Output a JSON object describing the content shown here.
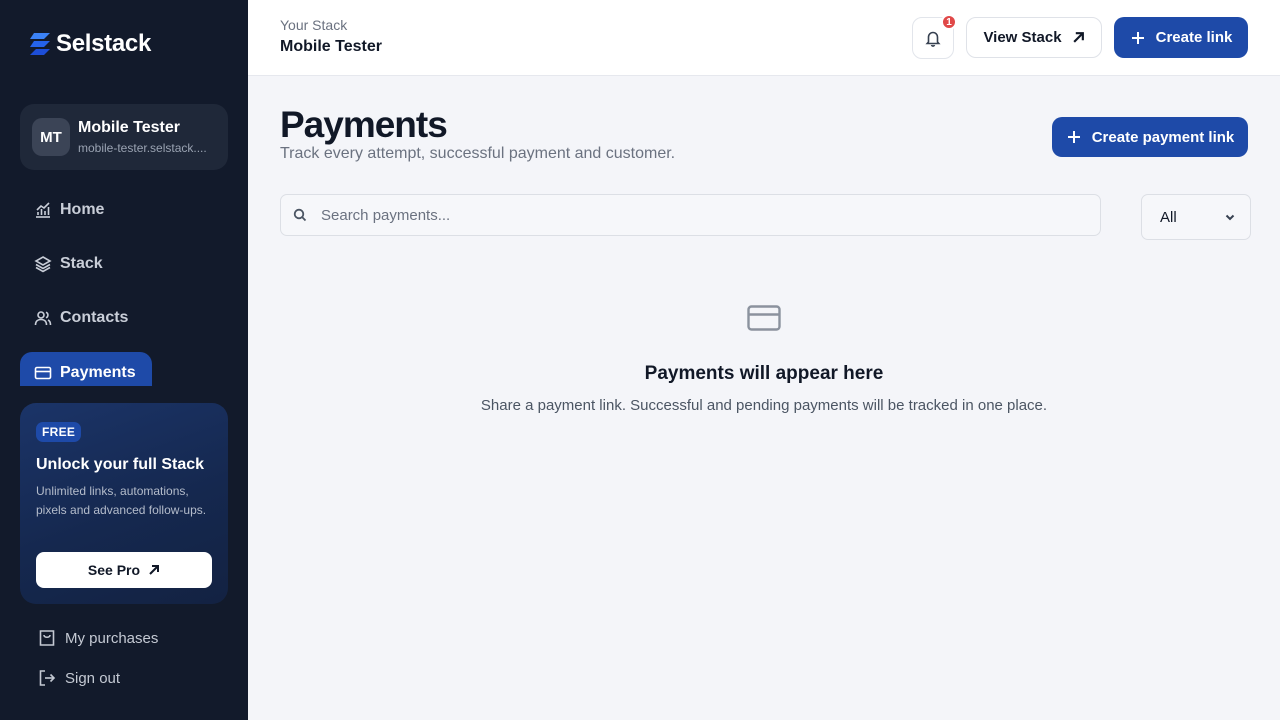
{
  "app": {
    "name": "Selstack"
  },
  "sidebar": {
    "profile": {
      "initials": "MT",
      "name": "Mobile Tester",
      "url": "mobile-tester.selstack...."
    },
    "nav": [
      {
        "label": "Home",
        "icon": "chart-icon"
      },
      {
        "label": "Stack",
        "icon": "layers-icon"
      },
      {
        "label": "Contacts",
        "icon": "users-icon"
      },
      {
        "label": "Payments",
        "icon": "credit-card-icon",
        "active": true
      }
    ],
    "promo": {
      "badge": "FREE",
      "title": "Unlock your full Stack",
      "description": "Unlimited links, automations, pixels and advanced follow-ups.",
      "button": "See Pro"
    },
    "bottom_links": [
      {
        "label": "My purchases",
        "icon": "shopping-bag-icon"
      },
      {
        "label": "Sign out",
        "icon": "sign-out-icon"
      }
    ]
  },
  "header": {
    "subtitle": "Your Stack",
    "title": "Mobile Tester",
    "notifications_count": "1",
    "view_stack_label": "View Stack",
    "create_link_label": "Create link"
  },
  "main": {
    "title": "Payments",
    "subtitle": "Track every attempt, successful payment and customer.",
    "create_payment_label": "Create payment link",
    "search_placeholder": "Search payments...",
    "filter_value": "All",
    "empty_title": "Payments will appear here",
    "empty_description": "Share a payment link. Successful and pending payments will be tracked in one place."
  },
  "colors": {
    "primary": "#1e4aa8",
    "sidebar_bg": "#121a2b",
    "badge_red": "#e04848"
  }
}
